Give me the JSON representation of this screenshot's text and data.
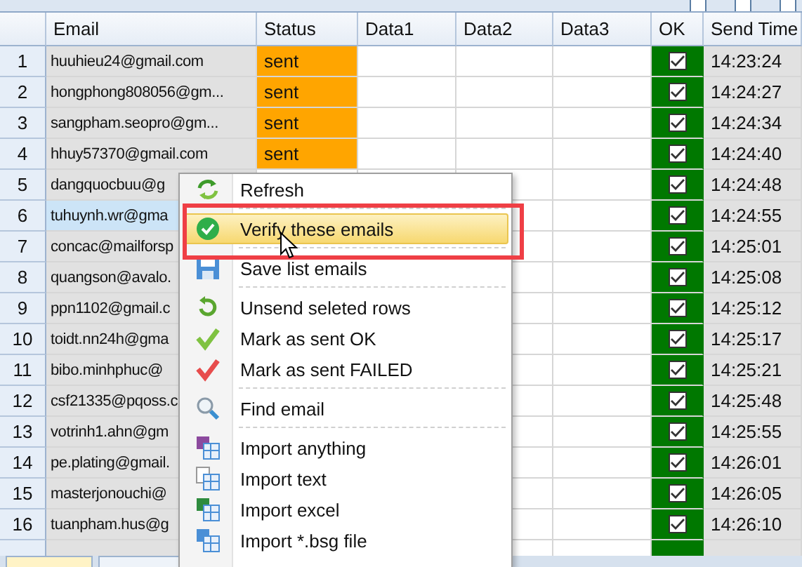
{
  "table": {
    "columns": [
      "Email",
      "Status",
      "Data1",
      "Data2",
      "Data3",
      "OK",
      "Send Time"
    ],
    "rows": [
      {
        "number": "1",
        "email": "huuhieu24@gmail.com",
        "status": "sent",
        "ok": true,
        "send_time": "14:23:24",
        "selected": false
      },
      {
        "number": "2",
        "email": "hongphong808056@gm...",
        "status": "sent",
        "ok": true,
        "send_time": "14:24:27",
        "selected": false
      },
      {
        "number": "3",
        "email": "sangpham.seopro@gm...",
        "status": "sent",
        "ok": true,
        "send_time": "14:24:34",
        "selected": false
      },
      {
        "number": "4",
        "email": "hhuy57370@gmail.com",
        "status": "sent",
        "ok": true,
        "send_time": "14:24:40",
        "selected": false
      },
      {
        "number": "5",
        "email": "dangquocbuu@g",
        "ok": true,
        "send_time": "14:24:48",
        "selected": false
      },
      {
        "number": "6",
        "email": "tuhuynh.wr@gma",
        "ok": true,
        "send_time": "14:24:55",
        "selected": true
      },
      {
        "number": "7",
        "email": "concac@mailforsp",
        "ok": true,
        "send_time": "14:25:01",
        "selected": false
      },
      {
        "number": "8",
        "email": "quangson@avalo.",
        "ok": true,
        "send_time": "14:25:08",
        "selected": false
      },
      {
        "number": "9",
        "email": "ppn1102@gmail.c",
        "ok": true,
        "send_time": "14:25:12",
        "selected": false
      },
      {
        "number": "10",
        "email": "toidt.nn24h@gma",
        "ok": true,
        "send_time": "14:25:17",
        "selected": false
      },
      {
        "number": "11",
        "email": "bibo.minhphuc@",
        "ok": true,
        "send_time": "14:25:21",
        "selected": false
      },
      {
        "number": "12",
        "email": "csf21335@pqoss.c",
        "ok": true,
        "send_time": "14:25:48",
        "selected": false
      },
      {
        "number": "13",
        "email": "votrinh1.ahn@gm",
        "ok": true,
        "send_time": "14:25:55",
        "selected": false
      },
      {
        "number": "14",
        "email": "pe.plating@gmail.",
        "ok": true,
        "send_time": "14:26:01",
        "selected": false
      },
      {
        "number": "15",
        "email": "masterjonouchi@",
        "ok": true,
        "send_time": "14:26:05",
        "selected": false
      },
      {
        "number": "16",
        "email": "tuanpham.hus@g",
        "ok": true,
        "send_time": "14:26:10",
        "selected": false
      }
    ]
  },
  "context_menu": {
    "items": [
      {
        "kind": "item",
        "label": "Refresh",
        "selected": false
      },
      {
        "kind": "separator"
      },
      {
        "kind": "item",
        "label": "Verify these emails",
        "selected": true
      },
      {
        "kind": "separator"
      },
      {
        "kind": "item",
        "label": "Save list emails",
        "selected": false
      },
      {
        "kind": "separator"
      },
      {
        "kind": "item",
        "label": "Unsend seleted rows",
        "selected": false
      },
      {
        "kind": "item",
        "label": "Mark as sent OK",
        "selected": false
      },
      {
        "kind": "item",
        "label": "Mark as sent FAILED",
        "selected": false
      },
      {
        "kind": "separator"
      },
      {
        "kind": "item",
        "label": "Find email",
        "selected": false
      },
      {
        "kind": "separator"
      },
      {
        "kind": "item",
        "label": "Import anything",
        "selected": false
      },
      {
        "kind": "item",
        "label": "Import text",
        "selected": false
      },
      {
        "kind": "item",
        "label": "Import excel",
        "selected": false
      },
      {
        "kind": "item",
        "label": "Import *.bsg file",
        "selected": false
      }
    ]
  }
}
